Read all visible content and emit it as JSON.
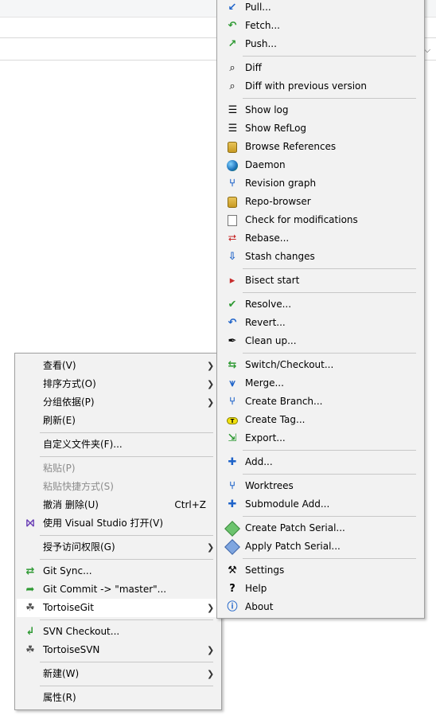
{
  "main_menu": {
    "items": [
      {
        "label": "查看(V)",
        "submenu": true
      },
      {
        "label": "排序方式(O)",
        "submenu": true
      },
      {
        "label": "分组依据(P)",
        "submenu": true
      },
      {
        "label": "刷新(E)"
      },
      {
        "label": "自定义文件夹(F)..."
      },
      {
        "label": "粘贴(P)",
        "disabled": true
      },
      {
        "label": "粘贴快捷方式(S)",
        "disabled": true
      },
      {
        "label": "撤消 删除(U)",
        "shortcut": "Ctrl+Z"
      },
      {
        "label": "使用 Visual Studio 打开(V)",
        "icon": "visual-studio-icon"
      },
      {
        "label": "授予访问权限(G)",
        "submenu": true
      },
      {
        "label": "Git Sync...",
        "icon": "git-sync-icon"
      },
      {
        "label": "Git Commit -> \"master\"...",
        "icon": "git-commit-icon"
      },
      {
        "label": "TortoiseGit",
        "icon": "tortoisegit-icon",
        "submenu": true,
        "highlighted": true
      },
      {
        "label": "SVN Checkout...",
        "icon": "svn-checkout-icon"
      },
      {
        "label": "TortoiseSVN",
        "icon": "tortoisesvn-icon",
        "submenu": true
      },
      {
        "label": "新建(W)",
        "submenu": true
      },
      {
        "label": "属性(R)"
      }
    ]
  },
  "tortoisegit_menu": {
    "items": [
      {
        "label": "Pull...",
        "icon": "pull-icon"
      },
      {
        "label": "Fetch...",
        "icon": "fetch-icon"
      },
      {
        "label": "Push...",
        "icon": "push-icon"
      },
      {
        "label": "Diff",
        "icon": "diff-icon"
      },
      {
        "label": "Diff with previous version",
        "icon": "diff-previous-icon"
      },
      {
        "label": "Show log",
        "icon": "show-log-icon"
      },
      {
        "label": "Show RefLog",
        "icon": "show-reflog-icon"
      },
      {
        "label": "Browse References",
        "icon": "browse-references-icon"
      },
      {
        "label": "Daemon",
        "icon": "daemon-icon"
      },
      {
        "label": "Revision graph",
        "icon": "revision-graph-icon"
      },
      {
        "label": "Repo-browser",
        "icon": "repo-browser-icon"
      },
      {
        "label": "Check for modifications",
        "icon": "check-modifications-icon"
      },
      {
        "label": "Rebase...",
        "icon": "rebase-icon"
      },
      {
        "label": "Stash changes",
        "icon": "stash-icon"
      },
      {
        "label": "Bisect start",
        "icon": "bisect-icon"
      },
      {
        "label": "Resolve...",
        "icon": "resolve-icon"
      },
      {
        "label": "Revert...",
        "icon": "revert-icon"
      },
      {
        "label": "Clean up...",
        "icon": "cleanup-icon"
      },
      {
        "label": "Switch/Checkout...",
        "icon": "switch-checkout-icon"
      },
      {
        "label": "Merge...",
        "icon": "merge-icon"
      },
      {
        "label": "Create Branch...",
        "icon": "create-branch-icon"
      },
      {
        "label": "Create Tag...",
        "icon": "create-tag-icon"
      },
      {
        "label": "Export...",
        "icon": "export-icon"
      },
      {
        "label": "Add...",
        "icon": "add-icon"
      },
      {
        "label": "Worktrees",
        "icon": "worktrees-icon"
      },
      {
        "label": "Submodule Add...",
        "icon": "submodule-add-icon"
      },
      {
        "label": "Create Patch Serial...",
        "icon": "create-patch-icon"
      },
      {
        "label": "Apply Patch Serial...",
        "icon": "apply-patch-icon"
      },
      {
        "label": "Settings",
        "icon": "settings-icon"
      },
      {
        "label": "Help",
        "icon": "help-icon"
      },
      {
        "label": "About",
        "icon": "about-icon"
      }
    ]
  },
  "colors": {
    "menu_background": "#f2f2f2",
    "highlight": "#ffffff",
    "disabled_text": "#8c8c8c",
    "separator": "#c8c8c8"
  }
}
